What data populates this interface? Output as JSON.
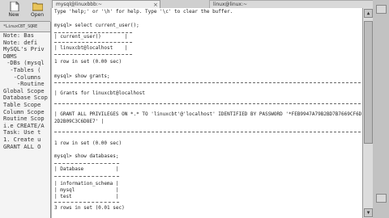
{
  "toolbar": {
    "new_label": "New",
    "open_label": "Open"
  },
  "tabs": {
    "active": "mysql@linuxbbb:~",
    "inactive": "linux@linux:~"
  },
  "left_pane": {
    "tab": "*LinuxCBT_SQRE",
    "lines": [
      "Note: Bas",
      "Note: defi",
      "",
      "MySQL's Priv",
      "DBMS",
      " -DBs (mysql",
      "  -Tables (",
      "   -Columns",
      "    -Routine",
      "",
      "Global Scope",
      "Database Scop",
      "Table Scope",
      "Column Scope",
      "Routine Scop",
      "i.e CREATE/A",
      "",
      "Task: Use t",
      "1. Create u",
      "",
      "GRANT ALL O"
    ]
  },
  "terminal": {
    "help_line": "Type 'help;' or '\\h' for help. Type '\\c' to clear the buffer.",
    "prompt1": "mysql> select current_user();",
    "header1": "| current_user()        |",
    "row1": "| linuxcbt@localhost    |",
    "count1": "1 row in set (0.00 sec)",
    "prompt2": "mysql> show grants;",
    "header2": "| Grants for linuxcbt@localhost",
    "row2": "| GRANT ALL PRIVILEGES ON *.* TO 'linuxcbt'@'localhost' IDENTIFIED BY PASSWORD '*FEB9947A79B2BD7B7669CF6D",
    "row2b": "2D2B09C3C6D8E7' |",
    "count2": "1 row in set (0.00 sec)",
    "prompt3": "mysql> show databases;",
    "header3": "| Database           |",
    "db_rows": [
      "| information_schema |",
      "| mysql              |",
      "| test               |"
    ],
    "count3": "3 rows in set (0.01 sec)"
  }
}
